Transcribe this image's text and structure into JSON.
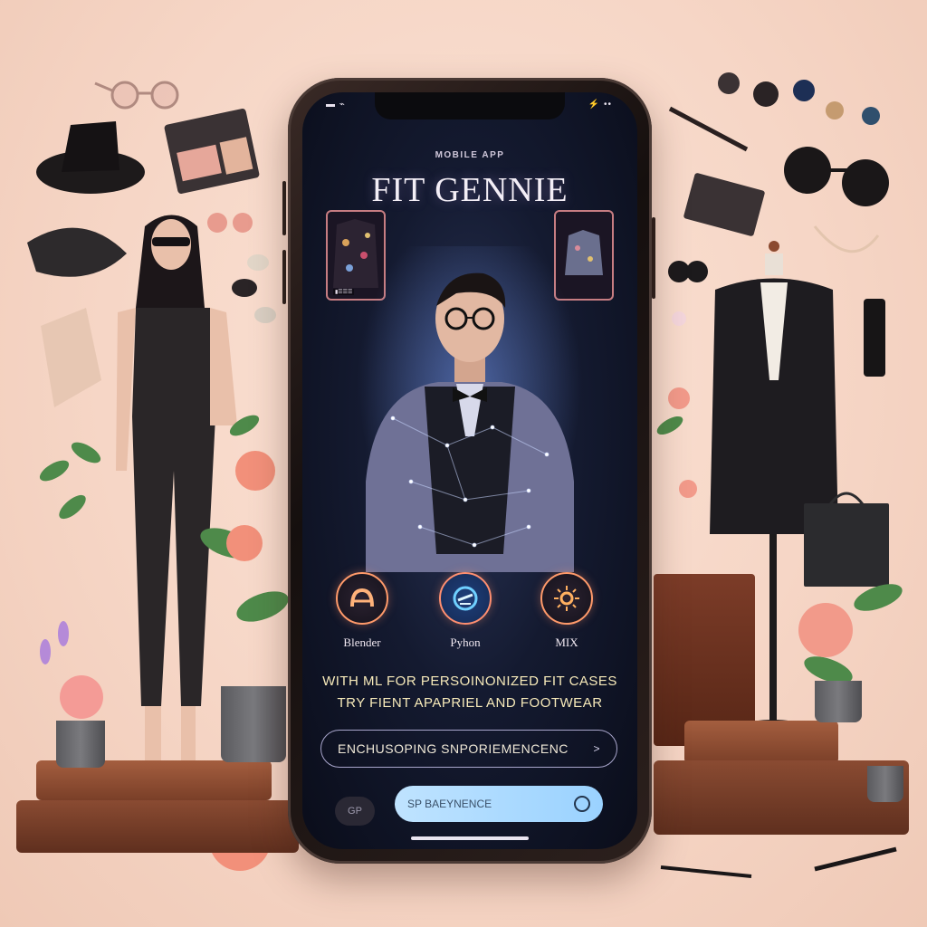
{
  "app": {
    "eyebrow": "MOBILE APP",
    "title": "FIT GENNIE",
    "status_left": "▬ ⌁",
    "status_right": "⚡ ••"
  },
  "products": [
    {
      "label": "▮☰☰☰"
    },
    {
      "label": ""
    }
  ],
  "tools": [
    {
      "name": "Blender",
      "icon": "blender-icon"
    },
    {
      "name": "Pyhon",
      "icon": "python-icon"
    },
    {
      "name": "MIX",
      "icon": "sun-gear-icon"
    }
  ],
  "tagline": {
    "line1": "WITH ML FOR PERSOINONIZED FIT CASES",
    "line2": "TRY FIENT APAPRIEL AND FOOTWEAR"
  },
  "cta": {
    "label": "ENCHUSOPING SNPORIEMENCENC",
    "arrow": ">"
  },
  "lang_chip": "GP",
  "search": {
    "value": "SP BAEYNENCE"
  },
  "colors": {
    "screen_bg": "#141a30",
    "title": "#f3eef6",
    "tagline": "#f7eaba",
    "accent_ring": "#ff9a6a",
    "search_bg": "#9ad2ff",
    "background": "#f6d6c6"
  }
}
